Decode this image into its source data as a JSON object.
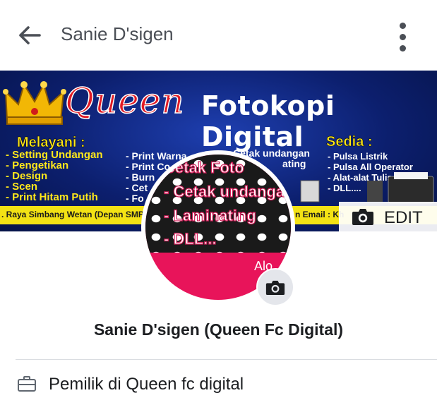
{
  "header": {
    "title": "Sanie D'sigen",
    "back_icon": "back-arrow-icon",
    "more_icon": "more-vertical-icon"
  },
  "cover": {
    "brand_queen": "Queen",
    "brand_fotokopi": "Fotokopi Digital",
    "melayani_title": "Melayani :",
    "melayani_items": [
      "- Setting Undangan",
      "- Pengetikan",
      "- Design",
      "- Scen",
      "- Print Hitam Putih"
    ],
    "print_items": [
      "- Print Warna",
      "- Print Co",
      "- Burn",
      "- Cet",
      "- Fo"
    ],
    "cetak_items": [
      "Cetak undangan",
      "ating"
    ],
    "sedia_title": "Sedia :",
    "sedia_items": [
      "- Pulsa Listrik",
      "- Pulsa All Operator",
      "- Alat-alat Tulis",
      "- DLL...."
    ],
    "address_left": ". Raya Simbang Wetan (Depan SMP N",
    "address_right": "n Email : Kh",
    "edit_label": "EDIT",
    "edit_icon": "camera-icon"
  },
  "avatar": {
    "lines": [
      "Cetak Foto",
      "- Cetak undanga",
      "- Laminating",
      "- DLL..."
    ],
    "alo_text": "Alo",
    "camera_icon": "camera-icon"
  },
  "profile": {
    "name": "Sanie D'sigen (Queen Fc Digital)"
  },
  "intro": {
    "work_icon": "briefcase-icon",
    "work_text": "Pemilik di Queen fc digital"
  },
  "colors": {
    "cover_blue": "#0c1f6e",
    "brand_red": "#e01a24",
    "accent_yellow": "#ffe81a",
    "avatar_pink": "#e8145a"
  }
}
